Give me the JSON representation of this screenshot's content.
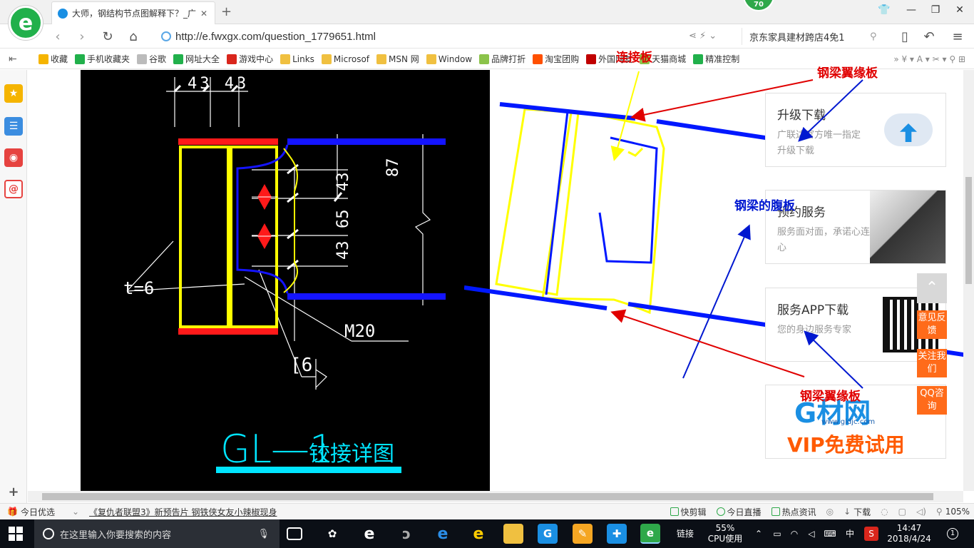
{
  "window": {
    "tab_title": "大师，钢结构节点图解释下？_广",
    "score_badge": "70"
  },
  "navbar": {
    "url": "http://e.fwxgx.com/question_1779651.html",
    "search_text": "京东家具建材跨店4免1"
  },
  "bookmarks": [
    {
      "label": "收藏",
      "color": "#f5b400"
    },
    {
      "label": "手机收藏夹",
      "color": "#21b04b"
    },
    {
      "label": "谷歌",
      "color": "#bbbbbb"
    },
    {
      "label": "网址大全",
      "color": "#21b04b"
    },
    {
      "label": "游戏中心",
      "color": "#d9261c"
    },
    {
      "label": "Links",
      "color": "#f0c040"
    },
    {
      "label": "Microsof",
      "color": "#f0c040"
    },
    {
      "label": "MSN 网",
      "color": "#f0c040"
    },
    {
      "label": "Window",
      "color": "#f0c040"
    },
    {
      "label": "品牌打折",
      "color": "#8bc34a"
    },
    {
      "label": "淘宝团购",
      "color": "#ff5000"
    },
    {
      "label": "外国网友",
      "color": "#c00000"
    },
    {
      "label": "天猫商城",
      "color": "#8bc34a"
    },
    {
      "label": "精准控制",
      "color": "#21b04b"
    }
  ],
  "drawing": {
    "dim_top": "43 43",
    "dim_43a": "43",
    "dim_65": "65",
    "dim_43b": "43",
    "dim_87": "87",
    "thickness": "t=6",
    "bolt": "M20",
    "weld": "[6",
    "title_big": "GL—1",
    "title_small": "铰接详图"
  },
  "annotations": {
    "connection_plate": "连接板",
    "top_flange": "钢梁翼缘板",
    "web": "钢梁的腹板",
    "bottom_flange": "钢梁翼缘板"
  },
  "cards": [
    {
      "title": "升级下载",
      "desc": "广联达官方唯一指定升级下载"
    },
    {
      "title": "预约服务",
      "desc": "服务面对面，承诺心连心"
    },
    {
      "title": "服务APP下载",
      "desc": "您的身边服务专家"
    }
  ],
  "ad": {
    "brand": "G材网",
    "url": "www.gldjc.com",
    "slogan": "VIP免费试用"
  },
  "float_buttons": [
    "意见反馈",
    "关注我们",
    "QQ咨询"
  ],
  "statusbar": {
    "today": "今日优选",
    "news": "《复仇者联盟3》新预告片 钢铁侠女友小辣椒现身",
    "items": [
      "快剪辑",
      "今日直播",
      "热点资讯"
    ],
    "download": "下载",
    "zoom": "105%"
  },
  "taskbar": {
    "search_placeholder": "在这里输入你要搜索的内容",
    "link_label": "链接",
    "cpu_percent": "55%",
    "cpu_label": "CPU使用",
    "ime": "中",
    "time": "14:47",
    "date": "2018/4/24",
    "notification_count": "1"
  },
  "colors": {
    "annotation_red": "#e00000",
    "annotation_blue": "#0018d0",
    "plate_yellow": "#ffff00",
    "drawing_bg": "#000000",
    "title_cyan": "#00e5ff",
    "float_orange": "#ff6b1a"
  }
}
